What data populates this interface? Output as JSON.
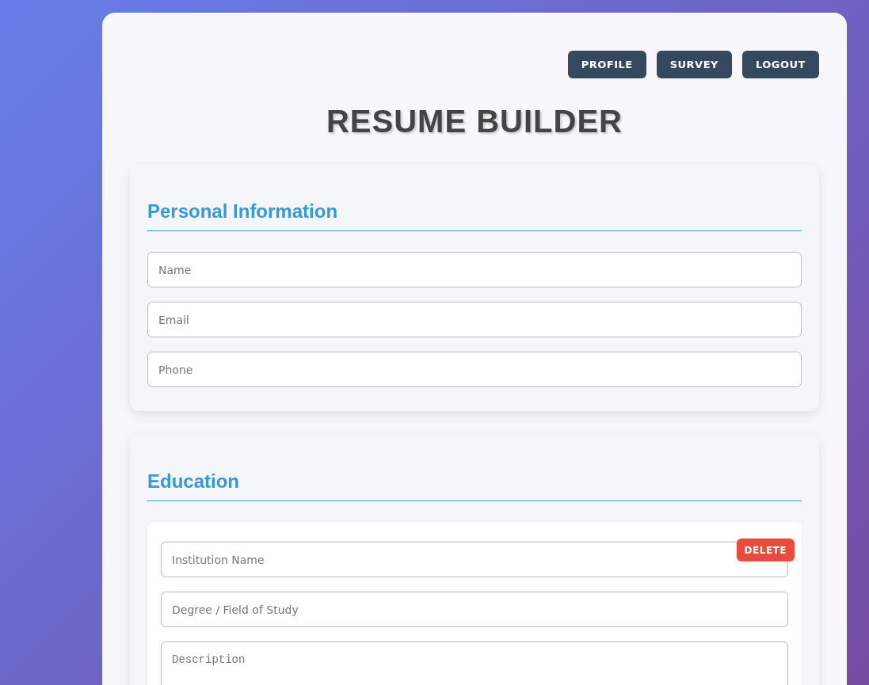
{
  "nav_buttons": [
    {
      "label": "PROFILE"
    },
    {
      "label": "SURVEY"
    },
    {
      "label": "LOGOUT"
    }
  ],
  "title": "RESUME BUILDER",
  "personal_information": {
    "heading": "Personal Information",
    "fields": [
      {
        "kind": "input",
        "placeholder": "Name"
      },
      {
        "kind": "input",
        "placeholder": "Email"
      },
      {
        "kind": "input",
        "placeholder": "Phone"
      }
    ]
  },
  "education": {
    "heading": "Education",
    "entries": [
      {
        "delete_label": "DELETE",
        "fields": [
          {
            "kind": "input",
            "placeholder": "Institution Name"
          },
          {
            "kind": "input",
            "placeholder": "Degree / Field of Study"
          },
          {
            "kind": "textarea",
            "placeholder": "Description"
          }
        ]
      }
    ]
  }
}
